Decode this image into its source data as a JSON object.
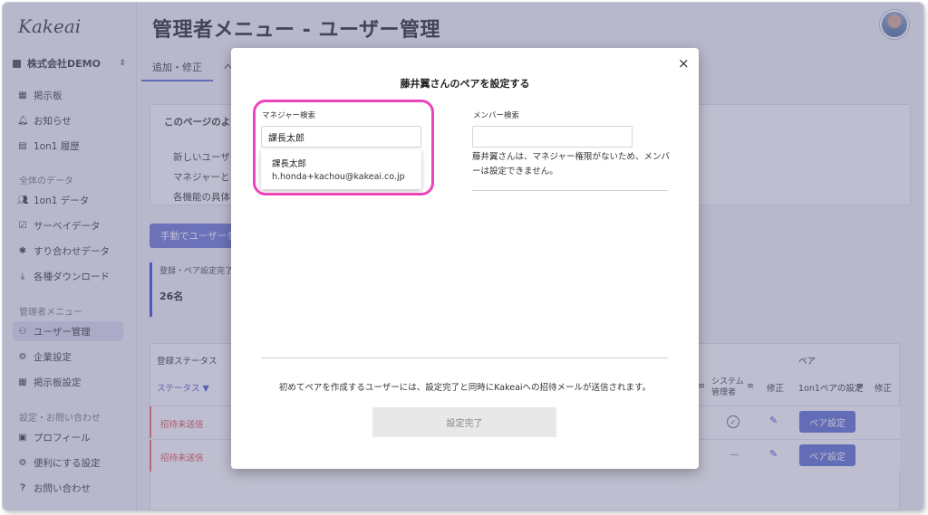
{
  "app": {
    "logo": "Kakeai",
    "page_title": "管理者メニュー - ユーザー管理"
  },
  "sidebar": {
    "company": "株式会社DEMO",
    "company_chevron": "⌃⌄",
    "items_top": [
      {
        "label": "掲示板",
        "icon": "board-icon"
      },
      {
        "label": "お知らせ",
        "icon": "bell-icon"
      },
      {
        "label": "1on1 履歴",
        "icon": "history-icon"
      }
    ],
    "section_data": "全体のデータ",
    "items_data": [
      {
        "label": "1on1 データ",
        "icon": "people-icon"
      },
      {
        "label": "サーベイデータ",
        "icon": "survey-icon"
      },
      {
        "label": "すり合わせデータ",
        "icon": "puzzle-icon"
      },
      {
        "label": "各種ダウンロード",
        "icon": "download-icon"
      }
    ],
    "section_admin": "管理者メニュー",
    "items_admin": [
      {
        "label": "ユーザー管理",
        "icon": "user-manage-icon",
        "active": true
      },
      {
        "label": "企業設定",
        "icon": "company-settings-icon"
      },
      {
        "label": "掲示板設定",
        "icon": "board-settings-icon"
      }
    ],
    "section_settings": "設定・お問い合わせ",
    "items_settings": [
      {
        "label": "プロフィール",
        "icon": "profile-icon"
      },
      {
        "label": "便利にする設定",
        "icon": "gear-icon"
      },
      {
        "label": "お問い合わせ",
        "icon": "help-icon"
      }
    ]
  },
  "background": {
    "tabs": [
      "追加・修正",
      "へ"
    ],
    "card_heading": "このページのよ",
    "card_lines": [
      "新しいユーザー",
      "マネジャーと",
      "各機能の具体"
    ],
    "manual_button": "手動でユーザーを",
    "stat_label": "登録・ペア設定完了",
    "stat_value": "26名",
    "table": {
      "group_status": "登録ステータス",
      "col_status": "ステータス",
      "group_pair": "ペア",
      "col_sysadmin_1": "システム",
      "col_sysadmin_2": "管理者",
      "col_edit": "修正",
      "col_pair_setting": "1on1ペアの設定",
      "col_edit_2": "修正",
      "rows": [
        {
          "status": "招待未送信",
          "sysadmin": "check",
          "pair_button": "ペア設定"
        },
        {
          "status": "招待未送信",
          "sysadmin": "—",
          "pair_button": "ペア設定"
        }
      ]
    }
  },
  "modal": {
    "title": "藤井翼さんのペアを設定する",
    "close": "×",
    "manager_label": "マネジャー検索",
    "manager_value": "課長太郎",
    "suggestion_name": "課長太郎",
    "suggestion_email": "h.honda+kachou@kakeai.co.jp",
    "member_label": "メンバー検索",
    "member_value": "",
    "member_note": "藤井翼さんは、マネジャー権限がないため、メンバーは設定できません。",
    "footer_note": "初めてペアを作成するユーザーには、設定完了と同時にKakeaiへの招待メールが送信されます。",
    "done_button": "設定完了"
  },
  "colors": {
    "accent": "#5a6acf",
    "highlight": "#ee44bb",
    "danger": "#dd4444"
  }
}
